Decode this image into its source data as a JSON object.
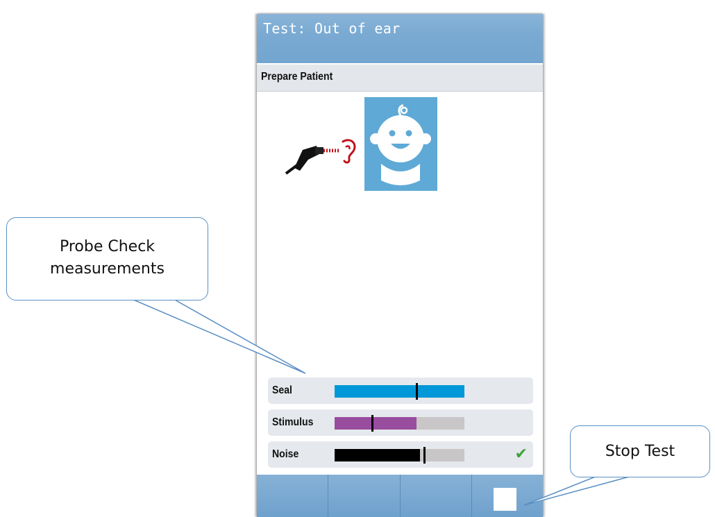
{
  "screen": {
    "title": "Test: Out of ear",
    "step": "Prepare Patient"
  },
  "probe_check": {
    "rows": [
      {
        "label": "Seal",
        "fill_percent": 100,
        "marker_percent": 63,
        "color": "#0098d8",
        "status": ""
      },
      {
        "label": "Stimulus",
        "fill_percent": 63,
        "marker_percent": 29,
        "color": "#984d9f",
        "status": ""
      },
      {
        "label": "Noise",
        "fill_percent": 66,
        "marker_percent": 69,
        "color": "#000000",
        "status": "check"
      }
    ]
  },
  "softkeys": [
    "",
    "",
    "",
    "stop"
  ],
  "callouts": {
    "probe_line1": "Probe Check",
    "probe_line2": "measurements",
    "stop": "Stop Test"
  },
  "icons": [
    "probe-icon",
    "ear-icon",
    "baby-face-icon",
    "check-icon",
    "stop-icon"
  ],
  "colors": {
    "header": "#7aaad2",
    "accent": "#5a8fc4",
    "ok": "#3aa438"
  }
}
